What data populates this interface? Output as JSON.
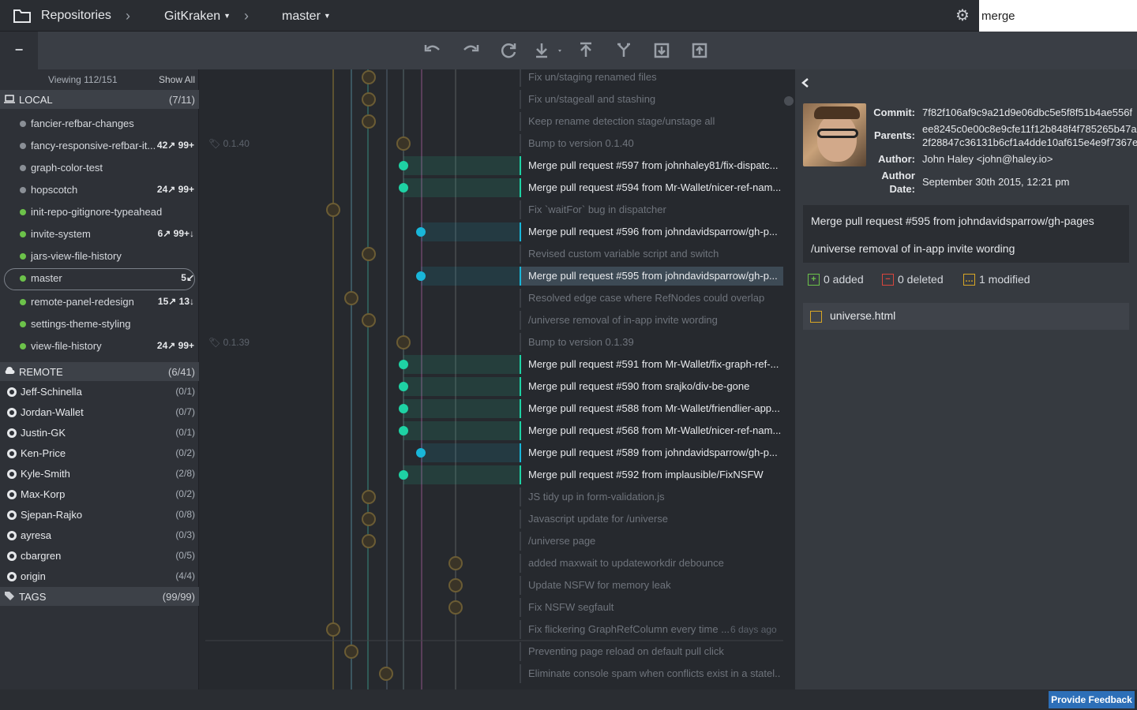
{
  "header": {
    "repositories": "Repositories",
    "repo_name": "GitKraken",
    "branch": "master",
    "search_value": "merge"
  },
  "sidebar": {
    "viewing": "Viewing 112/151",
    "show_all": "Show All",
    "local_label": "LOCAL",
    "local_count": "(7/11)",
    "local_branches": [
      {
        "name": "fancier-refbar-changes",
        "ab": "",
        "color": "#8a8f96"
      },
      {
        "name": "fancy-responsive-refbar-it...",
        "ab": "42↗ 99+",
        "color": "#8a8f96"
      },
      {
        "name": "graph-color-test",
        "ab": "",
        "color": "#8a8f96"
      },
      {
        "name": "hopscotch",
        "ab": "24↗ 99+",
        "color": "#8a8f96"
      },
      {
        "name": "init-repo-gitignore-typeahead",
        "ab": "",
        "color": "#6cc24a"
      },
      {
        "name": "invite-system",
        "ab": "6↗ 99+↓",
        "color": "#6cc24a"
      },
      {
        "name": "jars-view-file-history",
        "ab": "",
        "color": "#6cc24a"
      },
      {
        "name": "master",
        "ab": "5↙",
        "color": "#6cc24a"
      },
      {
        "name": "remote-panel-redesign",
        "ab": "15↗ 13↓",
        "color": "#6cc24a"
      },
      {
        "name": "settings-theme-styling",
        "ab": "",
        "color": "#6cc24a"
      },
      {
        "name": "view-file-history",
        "ab": "24↗ 99+",
        "color": "#6cc24a"
      }
    ],
    "remote_label": "REMOTE",
    "remote_count": "(6/41)",
    "remotes": [
      {
        "name": "Jeff-Schinella",
        "count": "(0/1)"
      },
      {
        "name": "Jordan-Wallet",
        "count": "(0/7)"
      },
      {
        "name": "Justin-GK",
        "count": "(0/1)"
      },
      {
        "name": "Ken-Price",
        "count": "(0/2)"
      },
      {
        "name": "Kyle-Smith",
        "count": "(2/8)"
      },
      {
        "name": "Max-Korp",
        "count": "(0/2)"
      },
      {
        "name": "Sjepan-Rajko",
        "count": "(0/8)"
      },
      {
        "name": "ayresa",
        "count": "(0/3)"
      },
      {
        "name": "cbargren",
        "count": "(0/5)"
      },
      {
        "name": "origin",
        "count": "(4/4)"
      }
    ],
    "tags_label": "TAGS",
    "tags_count": "(99/99)"
  },
  "graph": {
    "tags": [
      "0.1.40",
      "0.1.39"
    ],
    "commits": [
      {
        "msg": "Fix un/staging renamed files",
        "style": "dim"
      },
      {
        "msg": "Fix un/stageall and stashing",
        "style": "dim"
      },
      {
        "msg": "Keep rename detection stage/unstage all",
        "style": "dim"
      },
      {
        "msg": "Bump to version 0.1.40",
        "style": "dim"
      },
      {
        "msg": "Merge pull request #597 from johnhaley81/fix-dispatc...",
        "style": "hi-green"
      },
      {
        "msg": "Merge pull request #594 from Mr-Wallet/nicer-ref-nam...",
        "style": "hi-green"
      },
      {
        "msg": "Fix `waitFor` bug in dispatcher",
        "style": "dim"
      },
      {
        "msg": "Merge pull request #596 from johndavidsparrow/gh-p...",
        "style": "hi-blue"
      },
      {
        "msg": "Revised custom variable script and switch",
        "style": "dim"
      },
      {
        "msg": "Merge pull request #595 from johndavidsparrow/gh-p...",
        "style": "sel"
      },
      {
        "msg": "Resolved edge case where RefNodes could overlap",
        "style": "dim"
      },
      {
        "msg": "/universe removal of in-app invite wording",
        "style": "dim"
      },
      {
        "msg": "Bump to version 0.1.39",
        "style": "dim"
      },
      {
        "msg": "Merge pull request #591 from Mr-Wallet/fix-graph-ref-...",
        "style": "hi-green"
      },
      {
        "msg": "Merge pull request #590 from srajko/div-be-gone",
        "style": "hi-green"
      },
      {
        "msg": "Merge pull request #588 from Mr-Wallet/friendlier-app...",
        "style": "hi-green"
      },
      {
        "msg": "Merge pull request #568 from Mr-Wallet/nicer-ref-nam...",
        "style": "hi-green"
      },
      {
        "msg": "Merge pull request #589 from johndavidsparrow/gh-p...",
        "style": "hi-blue"
      },
      {
        "msg": "Merge pull request #592 from implausible/FixNSFW",
        "style": "hi-green"
      },
      {
        "msg": "JS tidy up in form-validation.js",
        "style": "dim"
      },
      {
        "msg": "Javascript update for /universe",
        "style": "dim"
      },
      {
        "msg": "/universe page",
        "style": "dim"
      },
      {
        "msg": "added maxwait to updateworkdir debounce",
        "style": "dim"
      },
      {
        "msg": "Update NSFW for memory leak",
        "style": "dim"
      },
      {
        "msg": "Fix NSFW segfault",
        "style": "dim"
      },
      {
        "msg": "Fix flickering GraphRefColumn every time ...",
        "style": "dim"
      },
      {
        "msg": "Preventing page reload on default pull click",
        "style": "dim"
      },
      {
        "msg": "Eliminate console spam when conflicts exist in a statel...",
        "style": "dim"
      }
    ],
    "time_ago": "6 days ago"
  },
  "panel": {
    "commit_label": "Commit:",
    "commit_sha": "7f82f106af9c9a21d9e06dbc5e5f8f51b4ae556f",
    "parents_label": "Parents:",
    "parent_1": "ee8245c0e00c8e9cfe11f12b848f4f785265b47a",
    "parent_2": "2f28847c36131b6cf1a4dde10af615e4e9f7367e",
    "author_label": "Author:",
    "author": "John Haley <john@haley.io>",
    "date_label_1": "Author",
    "date_label_2": "Date:",
    "date": "September 30th 2015, 12:21 pm",
    "message_1": "Merge pull request #595 from johndavidsparrow/gh-pages",
    "message_2": "/universe removal of in-app invite wording",
    "added": "0 added",
    "deleted": "0 deleted",
    "modified": "1 modified",
    "file": "universe.html"
  },
  "footer": {
    "feedback": "Provide Feedback"
  },
  "colors": {
    "green": "#1ed2a4",
    "blue": "#19b6d9",
    "accent": "#2d6fb8"
  }
}
